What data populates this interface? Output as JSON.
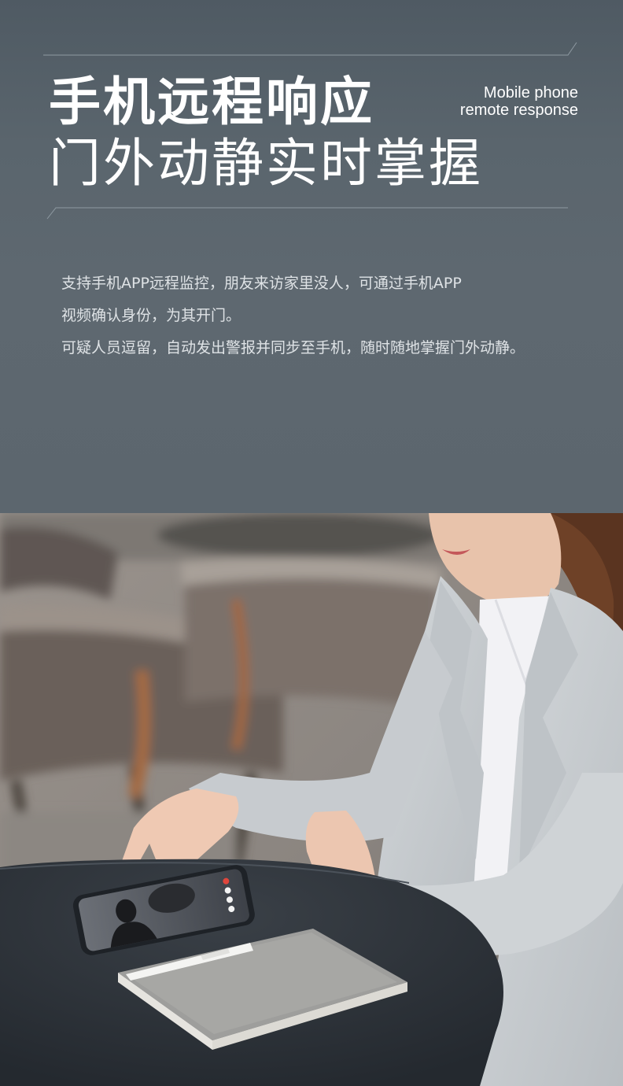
{
  "headline": {
    "main": "手机远程响应",
    "sub": "门外动静实时掌握"
  },
  "tagline": {
    "line1": "Mobile phone",
    "line2": "remote response"
  },
  "description": [
    "支持手机APP远程监控，朋友来访家里没人，可通过手机APP",
    "视频确认身份，为其开门。",
    "可疑人员逗留，自动发出警报并同步至手机，随时随地掌握门外动静。"
  ],
  "colors": {
    "panel_background": "#5a656d",
    "headline_text": "#ffffff",
    "body_text": "#dfe3e6",
    "blazer": "#c9cdd0",
    "table_top": "#2c3138"
  }
}
